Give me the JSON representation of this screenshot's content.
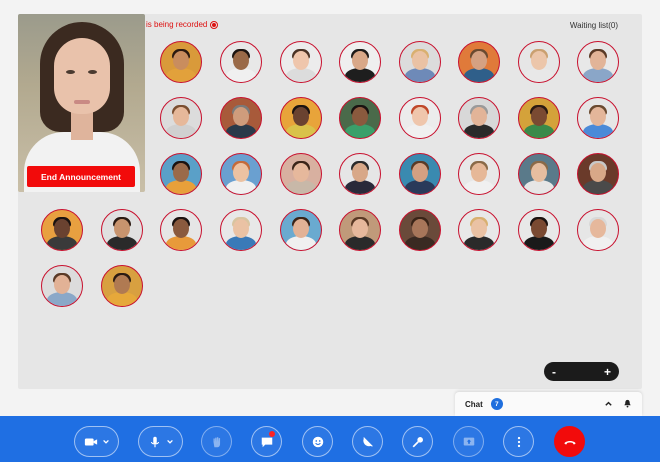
{
  "recording": {
    "text": "is being recorded"
  },
  "waiting_list": {
    "label": "Waiting list(0)"
  },
  "presenter": {
    "end_label": "End Announcement"
  },
  "participants": [
    {
      "skin": "#c98d5e",
      "hair": "#2b1a10",
      "shirt": "#e2a13b",
      "bg": "#d99a3a"
    },
    {
      "skin": "#9a6a48",
      "hair": "#1c1410",
      "shirt": "#f0f0f0",
      "bg": "#e8e8e8"
    },
    {
      "skin": "#efc6ac",
      "hair": "#4a3224",
      "shirt": "#dcdcdc",
      "bg": "#ececec",
      "badge": true
    },
    {
      "skin": "#d9a888",
      "hair": "#1e1a18",
      "shirt": "#1e1e1e",
      "bg": "#efefef"
    },
    {
      "skin": "#eac2a4",
      "hair": "#d9b070",
      "shirt": "#6e8ab8",
      "bg": "#dcdcdc"
    },
    {
      "skin": "#d5a182",
      "hair": "#6a4a30",
      "shirt": "#2f5f8a",
      "bg": "#e07a3a"
    },
    {
      "skin": "#ecc6aa",
      "hair": "#caa070",
      "shirt": "#e8e8e8",
      "bg": "#e6e6e6"
    },
    {
      "skin": "#e2b498",
      "hair": "#5a3a26",
      "shirt": "#8aa6c8",
      "bg": "#e8e8e8"
    },
    {
      "skin": "#e6b89a",
      "hair": "#7a4e30",
      "shirt": "#d0d0d0",
      "bg": "#dcdcdc"
    },
    {
      "skin": "#cf9c7c",
      "hair": "#7a7a7a",
      "shirt": "#2a3a4a",
      "bg": "#a85a3a"
    },
    {
      "skin": "#6a4230",
      "hair": "#1a1210",
      "shirt": "#d9c24a",
      "bg": "#e8a43a"
    },
    {
      "skin": "#8a5a3e",
      "hair": "#1a1210",
      "shirt": "#3aa06a",
      "bg": "#4a6a4a"
    },
    {
      "skin": "#efc6ac",
      "hair": "#c0482a",
      "shirt": "#f0f0f0",
      "bg": "#ececec"
    },
    {
      "skin": "#e2b498",
      "hair": "#9a9a9a",
      "shirt": "#2a2a2a",
      "bg": "#d8d8d8"
    },
    {
      "skin": "#7a4a32",
      "hair": "#2a1a12",
      "shirt": "#3a8a4a",
      "bg": "#d4a23a"
    },
    {
      "skin": "#e4b69a",
      "hair": "#6a4a30",
      "shirt": "#4a8ad8",
      "bg": "#e6e6e6"
    },
    {
      "skin": "#9a6a4a",
      "hair": "#1a1210",
      "shirt": "#e8a03a",
      "bg": "#5aa0c8"
    },
    {
      "skin": "#ecc2a2",
      "hair": "#c46a3a",
      "shirt": "#f0f0f0",
      "bg": "#6aa0d0"
    },
    {
      "skin": "#e6b89c",
      "hair": "#3a2418",
      "shirt": "#c8b8a8",
      "bg": "#d8b0a0"
    },
    {
      "skin": "#d8a888",
      "hair": "#2a2a2a",
      "shirt": "#2a2a3a",
      "bg": "#e6e6e6"
    },
    {
      "skin": "#d4a082",
      "hair": "#5a3a26",
      "shirt": "#2a3a5a",
      "bg": "#3a8ab0"
    },
    {
      "skin": "#e6b898",
      "hair": "#8a6a48",
      "shirt": "#f0f0f0",
      "bg": "#e8e8e8"
    },
    {
      "skin": "#e6bea0",
      "hair": "#8a6a48",
      "shirt": "#e6e6e6",
      "bg": "#5a7a8a"
    },
    {
      "skin": "#d8a888",
      "hair": "#c8c8c8",
      "shirt": "#4a4a4a",
      "bg": "#6a3a2a"
    },
    {
      "skin": "#6a4230",
      "hair": "#1a1210",
      "shirt": "#3a3a3a",
      "bg": "#e8a040"
    },
    {
      "skin": "#c8946e",
      "hair": "#2a1a12",
      "shirt": "#2a2a2a",
      "bg": "#e0e0e0"
    },
    {
      "skin": "#8a5a3e",
      "hair": "#1a1210",
      "shirt": "#e89a3a",
      "bg": "#e6e6e6"
    },
    {
      "skin": "#eac2a4",
      "hair": "#d8c4a0",
      "shirt": "#3a7ab8",
      "bg": "#e8e8e8"
    },
    {
      "skin": "#e2b296",
      "hair": "#3a2418",
      "shirt": "#f0f0f0",
      "bg": "#6aaad0"
    },
    {
      "skin": "#e6b89c",
      "hair": "#5a3a26",
      "shirt": "#2a2a2a",
      "bg": "#c09a7a"
    },
    {
      "skin": "#a8765a",
      "hair": "#3a2418",
      "shirt": "#3a2a22",
      "bg": "#6a4a3a"
    },
    {
      "skin": "#eac2a4",
      "hair": "#d8b070",
      "shirt": "#2a2a2a",
      "bg": "#e8e8e8"
    },
    {
      "skin": "#7a4a32",
      "hair": "#1a1210",
      "shirt": "#1a1a1a",
      "bg": "#e8e8e8"
    },
    {
      "skin": "#e6b89c",
      "hair": "#d8d8d8",
      "shirt": "#f0f0f0",
      "bg": "#e6e6e6"
    },
    {
      "skin": "#e2b296",
      "hair": "#5a3a26",
      "shirt": "#8aa8c8",
      "bg": "#dcdcdc"
    },
    {
      "skin": "#b07a52",
      "hair": "#2a1a12",
      "shirt": "#e6a83a",
      "bg": "#d8a040"
    }
  ],
  "zoom": {
    "minus": "-",
    "plus": "+"
  },
  "chat": {
    "label": "Chat",
    "count": "7"
  },
  "toolbar": {
    "buttons": [
      "video-camera",
      "microphone",
      "raise-hand",
      "chat-bubble",
      "emoji",
      "announcement",
      "key",
      "screen-share",
      "more",
      "end-call"
    ]
  },
  "colors": {
    "accent": "#1f6fe3",
    "danger": "#f20b0b",
    "ring": "#c8102e"
  }
}
